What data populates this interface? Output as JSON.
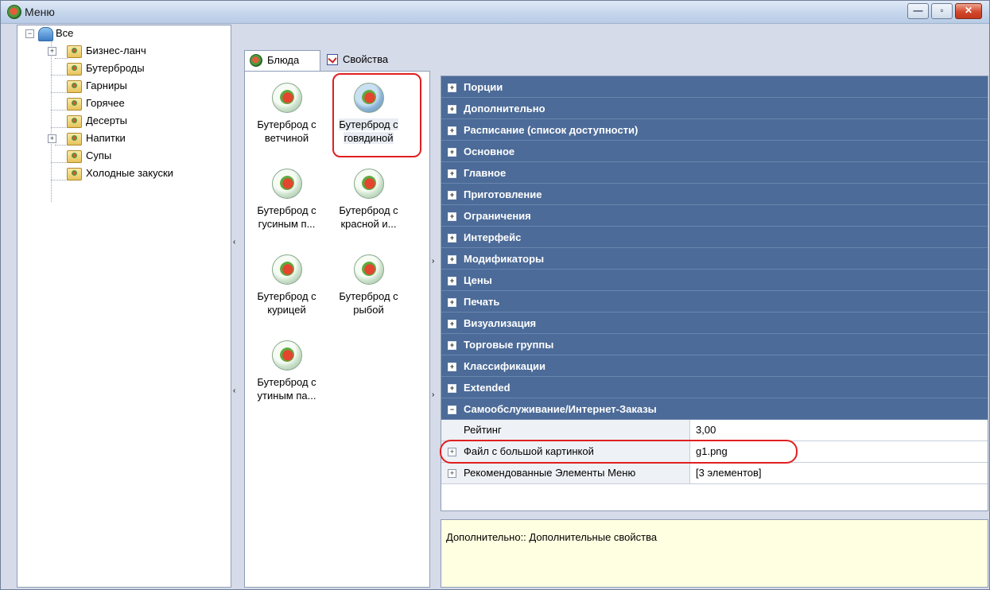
{
  "window": {
    "title": "Меню",
    "buttons": {
      "minimize": "—",
      "maximize": "▫",
      "close": "✕"
    }
  },
  "tree": {
    "root": "Все",
    "items": [
      {
        "label": "Бизнес-ланч",
        "expandable": true
      },
      {
        "label": "Бутерброды",
        "expandable": false,
        "selected": true
      },
      {
        "label": "Гарниры",
        "expandable": false
      },
      {
        "label": "Горячее",
        "expandable": false
      },
      {
        "label": "Десерты",
        "expandable": false
      },
      {
        "label": "Напитки",
        "expandable": true
      },
      {
        "label": "Супы",
        "expandable": false
      },
      {
        "label": "Холодные закуски",
        "expandable": false
      }
    ]
  },
  "tabs": [
    {
      "label": "Блюда",
      "active": true
    },
    {
      "label": "Свойства",
      "active": false
    }
  ],
  "dishes": [
    {
      "line1": "Бутерброд с",
      "line2": "ветчиной"
    },
    {
      "line1": "Бутерброд с",
      "line2": "говядиной",
      "selected": true
    },
    {
      "line1": "Бутерброд с",
      "line2": "гусиным п..."
    },
    {
      "line1": "Бутерброд с",
      "line2": "красной и..."
    },
    {
      "line1": "Бутерброд с",
      "line2": "курицей"
    },
    {
      "line1": "Бутерброд с",
      "line2": "рыбой"
    },
    {
      "line1": "Бутерброд с",
      "line2": "утиным па..."
    }
  ],
  "properties": {
    "categories": [
      "Порции",
      "Дополнительно",
      "Расписание (список доступности)",
      "Основное",
      "Главное",
      "Приготовление",
      "Ограничения",
      "Интерфейс",
      "Модификаторы",
      "Цены",
      "Печать",
      "Визуализация",
      "Торговые группы",
      "Классификации",
      "Extended"
    ],
    "expanded": {
      "title": "Самообслуживание/Интернет-Заказы",
      "rows": [
        {
          "name": "Рейтинг",
          "value": "3,00",
          "expandable": false
        },
        {
          "name": "Файл с большой картинкой",
          "value": "g1.png",
          "expandable": true
        },
        {
          "name": "Рекомендованные Элементы Меню",
          "value": "[3 элементов]",
          "expandable": true
        }
      ]
    }
  },
  "description": "Дополнительно:: Дополнительные свойства",
  "colors": {
    "category_bg": "#4c6b98",
    "highlight": "#e02020",
    "description_bg": "#ffffe1"
  }
}
